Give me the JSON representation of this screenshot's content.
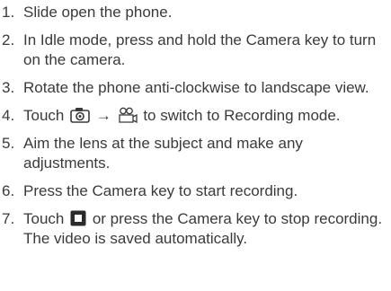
{
  "steps": [
    {
      "number": "1.",
      "text": "Slide open the phone."
    },
    {
      "number": "2.",
      "text": "In Idle mode, press and hold the Camera key to turn on the camera."
    },
    {
      "number": "3.",
      "text": "Rotate the phone anti-clockwise to landscape view."
    },
    {
      "number": "4.",
      "text_before": "Touch",
      "arrow": "→",
      "text_after": "to switch to Recording mode.",
      "icons": [
        "camera-settings-icon",
        "video-camera-icon"
      ]
    },
    {
      "number": "5.",
      "text": "Aim the lens at the subject and make any adjustments."
    },
    {
      "number": "6.",
      "text": "Press the Camera key to start recording."
    },
    {
      "number": "7.",
      "text_before": "Touch",
      "text_after": "or press the Camera key to stop recording.",
      "note": "The video is saved automatically.",
      "icons": [
        "stop-icon"
      ]
    }
  ]
}
